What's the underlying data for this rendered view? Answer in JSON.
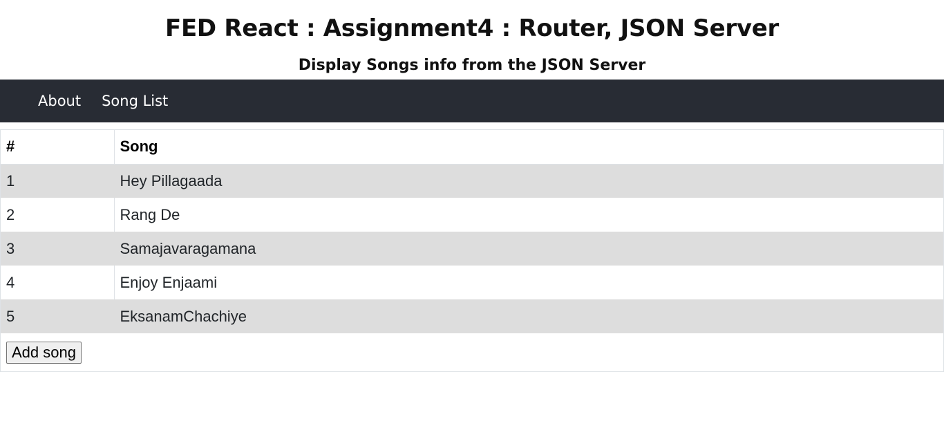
{
  "header": {
    "title": "FED React : Assignment4 : Router, JSON Server",
    "subtitle": "Display Songs info from the JSON Server"
  },
  "nav": {
    "items": [
      {
        "label": "About"
      },
      {
        "label": "Song List"
      }
    ]
  },
  "table": {
    "columns": [
      "#",
      "Song"
    ],
    "rows": [
      {
        "num": "1",
        "song": "Hey Pillagaada"
      },
      {
        "num": "2",
        "song": "Rang De"
      },
      {
        "num": "3",
        "song": "Samajavaragamana"
      },
      {
        "num": "4",
        "song": "Enjoy Enjaami"
      },
      {
        "num": "5",
        "song": "EksanamChachiye"
      }
    ]
  },
  "actions": {
    "add_label": "Add song"
  },
  "colors": {
    "navbar": "#282c34",
    "stripe": "#dddddd"
  }
}
